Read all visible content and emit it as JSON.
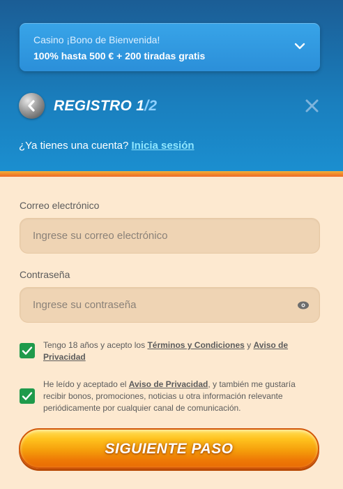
{
  "bonus": {
    "line1": "Casino ¡Bono de Bienvenida!",
    "line2": "100% hasta 500 € + 200 tiradas gratis"
  },
  "header": {
    "title": "REGISTRO 1",
    "step": "/2",
    "login_prompt": "¿Ya tienes una cuenta?",
    "login_link": "Inicia sesión"
  },
  "form": {
    "email_label": "Correo electrónico",
    "email_placeholder": "Ingrese su correo electrónico",
    "password_label": "Contraseña",
    "password_placeholder": "Ingrese su contraseña"
  },
  "consent1": {
    "checked": true,
    "prefix": "Tengo 18 años y acepto los ",
    "terms_link": "Términos y Condiciones",
    "middle": " y ",
    "privacy_link": "Aviso de Privacidad"
  },
  "consent2": {
    "checked": true,
    "prefix": "He leído y aceptado el ",
    "privacy_link": "Aviso de Privacidad",
    "suffix": ", y también me gustaría recibir bonos, promociones, noticias u otra información relevante periódicamente por cualquier canal de comunicación."
  },
  "actions": {
    "next_label": "SIGUIENTE PASO"
  },
  "colors": {
    "header_blue": "#1a7fbe",
    "accent_orange": "#f59e0b",
    "checkbox_green": "#1f9a4b"
  }
}
